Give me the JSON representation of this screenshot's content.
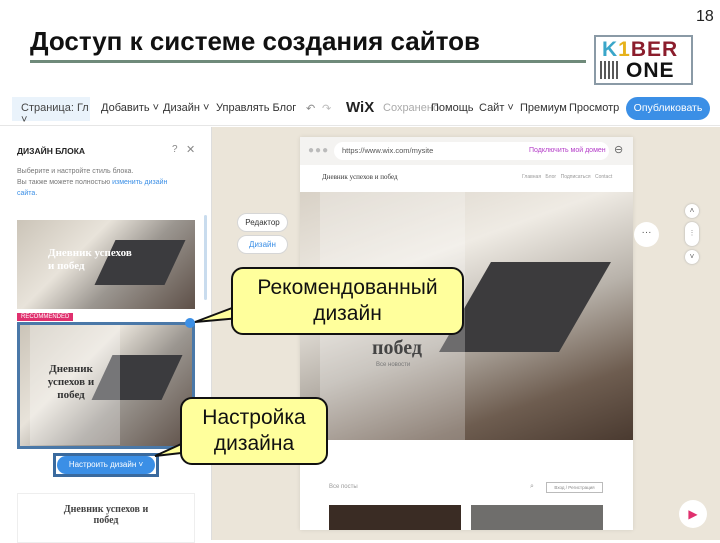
{
  "slide": {
    "title": "Доступ к системе создания сайтов",
    "page_number": "18",
    "logo_text": "KIBER ONE"
  },
  "toolbar": {
    "page_selector": "Страница: Гл",
    "add": "Добавить",
    "design": "Дизайн",
    "manage_blog": "Управлять Блог",
    "wix": "WiX",
    "saved": "Сохранено",
    "help": "Помощь",
    "site": "Сайт",
    "premium": "Премиум",
    "preview": "Просмотр",
    "publish": "Опубликовать"
  },
  "panel": {
    "heading": "ДИЗАЙН БЛОКА",
    "desc1": "Выберите и настройте стиль блока.",
    "desc2": "Вы также можете полностью ",
    "desc_link": "изменить дизайн сайта",
    "desc_end": ".",
    "thumb_title": "Дневник успехов и побед",
    "recommended": "RECOMMENDED",
    "customize_button": "Настроить дизайн"
  },
  "browser": {
    "url": "https://www.wix.com/mysite",
    "connect_domain": "Подключить мой домен",
    "site_title": "Дневник успехов и побед",
    "nav": [
      "Главная",
      "Блог",
      "Подписаться",
      "Contact"
    ],
    "hero_title": "побед",
    "hero_sub": "Все новости",
    "all_posts": "Все посты",
    "login": "Вход / Регистрация"
  },
  "editor": {
    "editor_btn": "Редактор",
    "design_btn": "Дизайн"
  },
  "callouts": {
    "recommended": "Рекомендованный дизайн",
    "customize": "Настройка дизайна"
  },
  "colors": {
    "accent": "#3b8fe6",
    "callout": "#ffff9c",
    "recommended_badge": "#e0306e",
    "domain_link": "#b43cc8"
  }
}
